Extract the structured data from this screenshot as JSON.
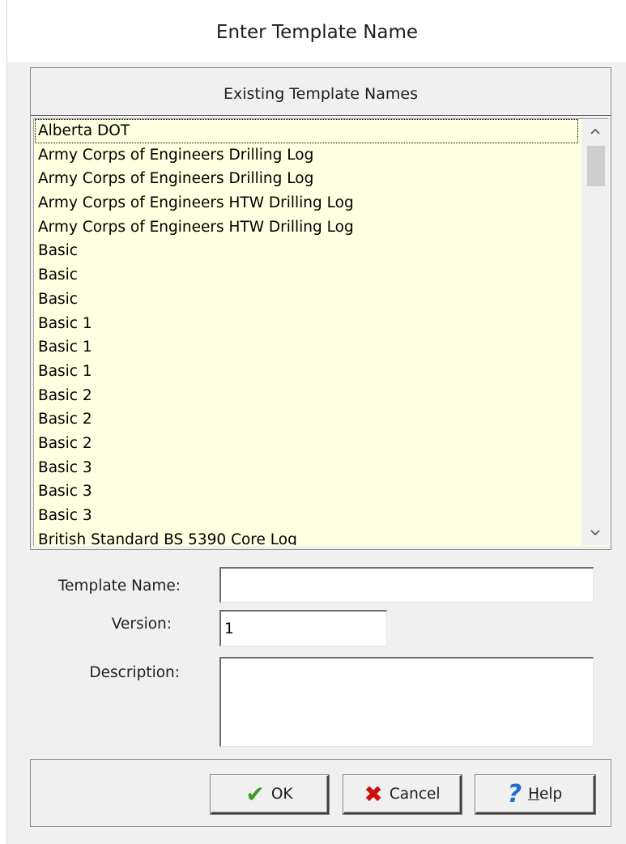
{
  "window": {
    "title": "Enter Template Name"
  },
  "list": {
    "header": "Existing Template Names",
    "items": [
      "Alberta DOT",
      "Army Corps of Engineers Drilling Log",
      "Army Corps of Engineers Drilling Log",
      "Army Corps of Engineers HTW Drilling Log",
      "Army Corps of Engineers HTW Drilling Log",
      "Basic",
      "Basic",
      "Basic",
      "Basic 1",
      "Basic 1",
      "Basic 1",
      "Basic 2",
      "Basic 2",
      "Basic 2",
      "Basic 3",
      "Basic 3",
      "Basic 3",
      "British Standard BS 5390 Core Log"
    ],
    "selected_index": 0,
    "scroll_up_icon": "chevron-up-icon",
    "scroll_down_icon": "chevron-down-icon"
  },
  "form": {
    "template_name_label": "Template Name:",
    "template_name_value": "",
    "version_label": "Version:",
    "version_value": "1",
    "description_label": "Description:",
    "description_value": ""
  },
  "buttons": {
    "ok_label": "OK",
    "ok_icon": "check-icon",
    "cancel_label": "Cancel",
    "cancel_icon": "x-icon",
    "help_label": "Help",
    "help_icon": "question-icon"
  }
}
